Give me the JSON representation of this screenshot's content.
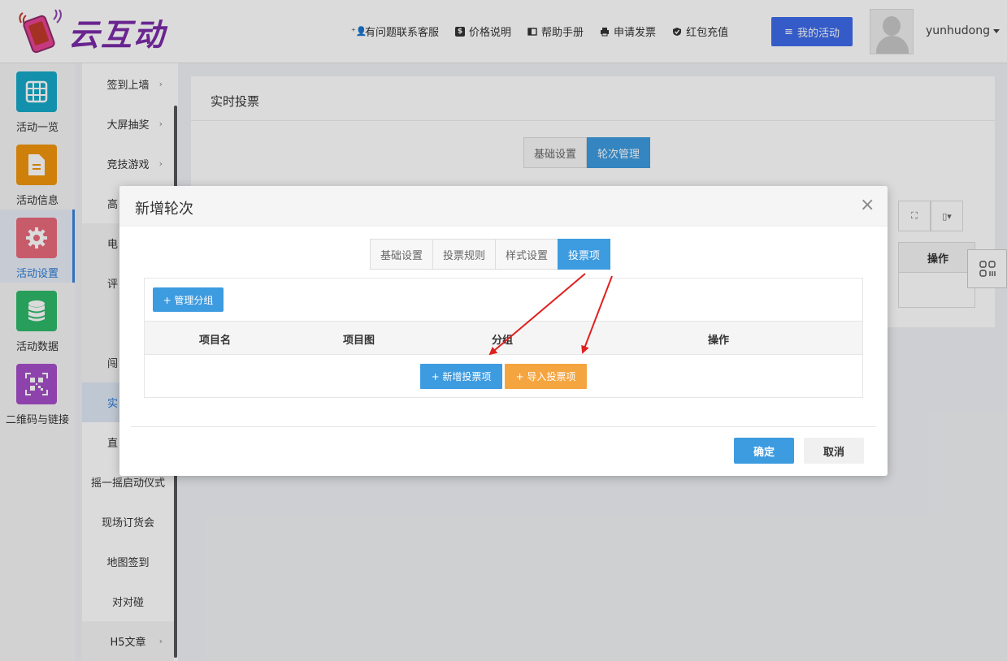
{
  "header": {
    "brand_name": "云互动",
    "links": [
      {
        "icon": "add-user-icon",
        "label": "有问题联系客服"
      },
      {
        "icon": "dollar-icon",
        "label": "价格说明"
      },
      {
        "icon": "book-icon",
        "label": "帮助手册"
      },
      {
        "icon": "printer-icon",
        "label": "申请发票"
      },
      {
        "icon": "shield-check-icon",
        "label": "红包充值"
      }
    ],
    "my_activity_label": "我的活动",
    "username": "yunhudong"
  },
  "main_nav": [
    {
      "label": "活动一览",
      "icon": "grid-icon",
      "color": "#17a8c8"
    },
    {
      "label": "活动信息",
      "icon": "document-icon",
      "color": "#f0960c"
    },
    {
      "label": "活动设置",
      "icon": "gear-icon",
      "color": "#e96a7c",
      "active": true
    },
    {
      "label": "活动数据",
      "icon": "database-icon",
      "color": "#2fb86a"
    },
    {
      "label": "二维码与链接",
      "icon": "qrcode-icon",
      "color": "#a64fc9"
    }
  ],
  "sub_nav": [
    {
      "label": "签到上墙",
      "chevron": true
    },
    {
      "label": "大屏抽奖",
      "chevron": true
    },
    {
      "label": "竞技游戏",
      "chevron": true
    },
    {
      "label": "高"
    },
    {
      "label": "电"
    },
    {
      "label": "评"
    },
    {
      "label": ""
    },
    {
      "label": "闯"
    },
    {
      "label": "实",
      "active": true
    },
    {
      "label": "直"
    },
    {
      "label": "摇一摇启动仪式"
    },
    {
      "label": "现场订货会"
    },
    {
      "label": "地图签到"
    },
    {
      "label": "对对碰"
    },
    {
      "label": "H5文章",
      "chevron": true
    }
  ],
  "panel": {
    "title": "实时投票",
    "tabs": [
      "基础设置",
      "轮次管理"
    ],
    "active_tab": 1,
    "table_header_action": "操作"
  },
  "modal": {
    "title": "新增轮次",
    "close_glyph": "×",
    "tabs": [
      "基础设置",
      "投票规则",
      "样式设置",
      "投票项"
    ],
    "active_tab": 3,
    "manage_group_label": "+ 管理分组",
    "columns": [
      "项目名",
      "项目图",
      "分组",
      "操作"
    ],
    "add_item_label": "+ 新增投票项",
    "import_item_label": "+ 导入投票项",
    "ok_label": "确定",
    "cancel_label": "取消"
  },
  "colors": {
    "primary": "#3d9be0",
    "brand_purple": "#7b2aa8",
    "import_orange": "#f5a540",
    "annotation_red": "#e0201e"
  }
}
